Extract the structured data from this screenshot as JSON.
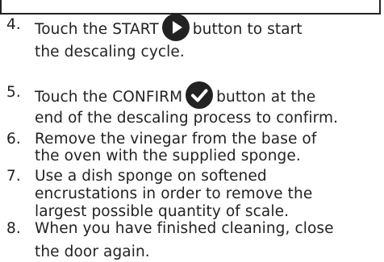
{
  "steps": [
    {
      "number": "4.",
      "line1_before": "Touch the START",
      "icon": "play-icon",
      "line1_after": "button to start",
      "line2": "the descaling cycle."
    },
    {
      "number": "5.",
      "line1_before": "Touch the CONFIRM",
      "icon": "checkmark-icon",
      "line1_after": "button at the",
      "line2": "end of the descaling process to confirm."
    },
    {
      "number": "6.",
      "line1": "Remove the vinegar from the base of",
      "line2": "the oven with the supplied sponge."
    },
    {
      "number": "7.",
      "line1": "Use a dish sponge on softened",
      "line2": "encrustations in order to remove the",
      "line3": "largest possible quantity of scale."
    },
    {
      "number": "8.",
      "line1": "When you have finished cleaning, close",
      "line2": "the door again."
    }
  ],
  "colors": {
    "text": "#222222",
    "icon_fill": "#222222",
    "icon_glyph": "#ffffff"
  }
}
